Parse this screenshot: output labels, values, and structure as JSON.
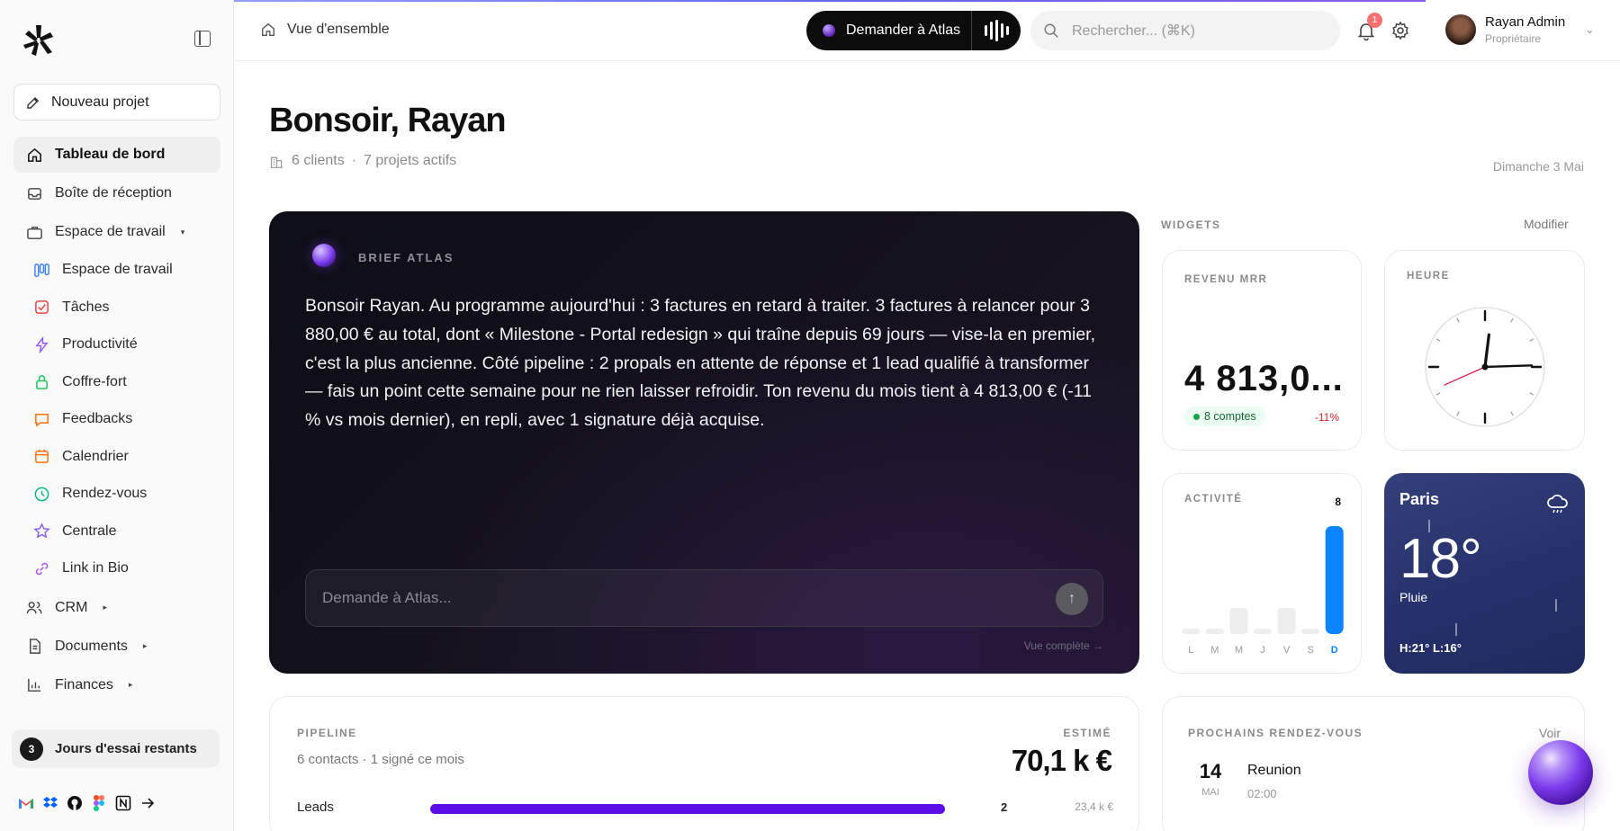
{
  "sidebar": {
    "new_project": "Nouveau projet",
    "items": [
      {
        "label": "Tableau de bord",
        "icon": "home-icon"
      },
      {
        "label": "Boîte de réception",
        "icon": "inbox-icon"
      },
      {
        "label": "Espace de travail",
        "icon": "briefcase-icon",
        "caret": "▾"
      },
      {
        "label": "Espace de travail",
        "icon": "kanban-icon",
        "color": "#3b82f6"
      },
      {
        "label": "Tâches",
        "icon": "checkbox-icon",
        "color": "#ef4444"
      },
      {
        "label": "Productivité",
        "icon": "bolt-icon",
        "color": "#8b5cf6"
      },
      {
        "label": "Coffre-fort",
        "icon": "lock-icon",
        "color": "#22c55e"
      },
      {
        "label": "Feedbacks",
        "icon": "chat-icon",
        "color": "#f97316"
      },
      {
        "label": "Calendrier",
        "icon": "calendar-icon",
        "color": "#f97316"
      },
      {
        "label": "Rendez-vous",
        "icon": "clock-icon",
        "color": "#10b981"
      },
      {
        "label": "Centrale",
        "icon": "star-icon",
        "color": "#8b5cf6"
      },
      {
        "label": "Link in Bio",
        "icon": "link-icon",
        "color": "#a855f7"
      },
      {
        "label": "CRM",
        "icon": "users-icon",
        "caret": "▸"
      },
      {
        "label": "Documents",
        "icon": "document-icon",
        "caret": "▸"
      },
      {
        "label": "Finances",
        "icon": "chart-icon",
        "caret": "▸"
      }
    ],
    "trial_count": "3",
    "trial_label": "Jours d'essai restants"
  },
  "header": {
    "breadcrumb": "Vue d'ensemble",
    "ask_atlas": "Demander à Atlas",
    "search_placeholder": "Rechercher... (⌘K)",
    "notifications": "1",
    "user_name": "Rayan Admin",
    "user_role": "Propriétaire"
  },
  "main": {
    "greeting": "Bonsoir, Rayan",
    "clients": "6 clients",
    "projects": "7 projets actifs",
    "date": "Dimanche 3 Mai"
  },
  "brief": {
    "label": "BRIEF ATLAS",
    "text": "Bonsoir Rayan. Au programme aujourd'hui : 3 factures en retard à traiter. 3 factures à relancer pour 3 880,00 € au total, dont « Milestone - Portal redesign » qui traîne depuis 69 jours — vise-la en premier, c'est la plus ancienne. Côté pipeline : 2 propals en attente de réponse et 1 lead qualifié à transformer — fais un point cette semaine pour ne rien laisser refroidir. Ton revenu du mois tient à 4 813,00 € (-11 % vs mois dernier), en repli, avec 1 signature déjà acquise.",
    "ask_placeholder": "Demande à Atlas...",
    "full_view": "Vue complète →"
  },
  "widgets": {
    "label": "WIDGETS",
    "edit": "Modifier",
    "mrr": {
      "label": "REVENU MRR",
      "value": "4 813,0...",
      "accounts": "8 comptes",
      "change": "-11%"
    },
    "clock": {
      "label": "HEURE",
      "hour": 12,
      "minute": 14,
      "second": 41
    },
    "activity": {
      "label": "ACTIVITÉ",
      "count": "8",
      "days": [
        "L",
        "M",
        "M",
        "J",
        "V",
        "S",
        "D"
      ],
      "values": [
        0,
        0,
        1,
        0,
        1,
        0,
        8
      ],
      "accent": "#0a84ff"
    },
    "weather": {
      "city": "Paris",
      "temp": "18°",
      "condition": "Pluie",
      "high_low": "H:21°  L:16°",
      "icon": "cloud-rain-icon"
    }
  },
  "pipeline": {
    "label": "PIPELINE",
    "contacts": "6 contacts",
    "signed": "1 signé ce mois",
    "estimate_label": "ESTIMÉ",
    "estimate": "70,1 k €",
    "rows": [
      {
        "name": "Leads",
        "count": "2",
        "amount": "23,4 k €",
        "fill": 1.0,
        "color": "#5b0ee8"
      }
    ]
  },
  "appointments": {
    "label": "PROCHAINS RENDEZ-VOUS",
    "see": "Voir",
    "items": [
      {
        "day": "14",
        "month": "MAI",
        "title": "Reunion",
        "time": "02:00"
      }
    ]
  },
  "footer_apps": [
    "gmail-icon",
    "dropbox-icon",
    "github-icon",
    "figma-icon",
    "notion-icon",
    "arrow-right-icon"
  ]
}
